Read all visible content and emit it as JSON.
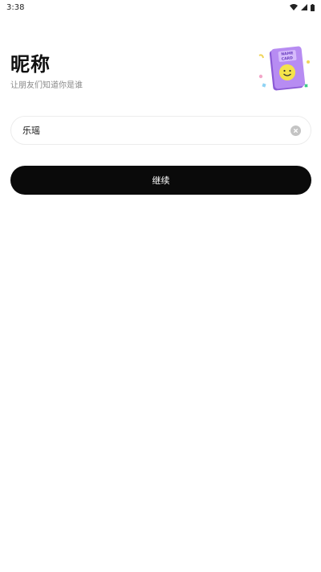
{
  "status_bar": {
    "time": "3:38",
    "icons": [
      "wifi-icon",
      "signal-icon",
      "battery-icon"
    ]
  },
  "header": {
    "title": "昵称",
    "subtitle": "让朋友们知道你是谁"
  },
  "illustration": {
    "icon": "name-card-icon",
    "text_line1": "NAME",
    "text_line2": "CARD"
  },
  "nickname_input": {
    "value": "乐瑶",
    "clear_icon": "clear-icon"
  },
  "continue_button": {
    "label": "继续"
  },
  "colors": {
    "primary_button": "#0a0a0a",
    "card_purple": "#b78cf2",
    "smiley_yellow": "#f4e34a",
    "subtitle_gray": "#8a8a8a"
  }
}
